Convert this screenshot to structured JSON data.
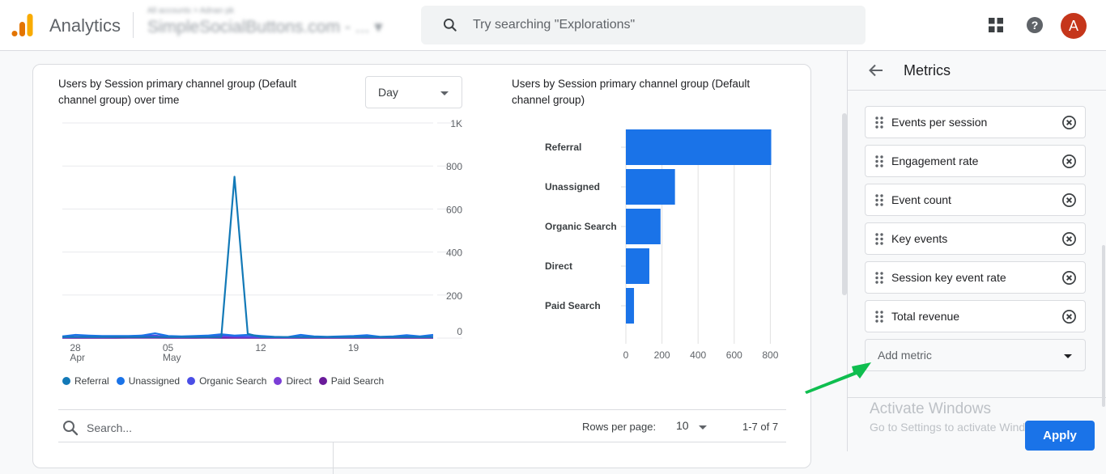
{
  "header": {
    "app_name": "Analytics",
    "account_breadcrumb": "All accounts > Adnan pk",
    "property_name": "SimpleSocialButtons.com - ...",
    "search_placeholder": "Try searching \"Explorations\"",
    "avatar_initial": "A",
    "icons": [
      "apps-grid-icon",
      "help-icon"
    ]
  },
  "card": {
    "line_chart_title": "Users by Session primary channel group (Default channel group) over time",
    "line_chart_title_lines": [
      "Users by Session primary channel group (Default",
      "channel group) over time"
    ],
    "granularity_select": "Day",
    "bar_chart_title_lines": [
      "Users by Session primary channel group (Default",
      "channel group)"
    ],
    "legend": [
      {
        "label": "Referral",
        "color": "#1279b7"
      },
      {
        "label": "Unassigned",
        "color": "#1a73e8"
      },
      {
        "label": "Organic Search",
        "color": "#4a4ee6"
      },
      {
        "label": "Direct",
        "color": "#7b3ed6"
      },
      {
        "label": "Paid Search",
        "color": "#6a1b9a"
      }
    ],
    "table": {
      "search_placeholder": "Search...",
      "rows_per_page_label": "Rows per page:",
      "rows_per_page_value": "10",
      "range_text": "1-7 of 7"
    }
  },
  "chart_data": [
    {
      "type": "line",
      "title": "Users by Session primary channel group (Default channel group) over time",
      "xlabel": "",
      "ylabel": "",
      "ylim": [
        0,
        1000
      ],
      "y_ticks": [
        "0",
        "200",
        "400",
        "600",
        "800",
        "1K"
      ],
      "x_tick_labels": [
        {
          "day": "28",
          "month": "Apr",
          "index": 1
        },
        {
          "day": "05",
          "month": "May",
          "index": 8
        },
        {
          "day": "12",
          "month": "",
          "index": 15
        },
        {
          "day": "19",
          "month": "",
          "index": 22
        }
      ],
      "x": [
        "Apr 27",
        "Apr 28",
        "Apr 29",
        "Apr 30",
        "May 1",
        "May 2",
        "May 3",
        "May 4",
        "May 5",
        "May 6",
        "May 7",
        "May 8",
        "May 9",
        "May 10",
        "May 11",
        "May 12",
        "May 13",
        "May 14",
        "May 15",
        "May 16",
        "May 17",
        "May 18",
        "May 19",
        "May 20",
        "May 21",
        "May 22",
        "May 23",
        "May 24",
        "May 25"
      ],
      "series": [
        {
          "name": "Referral",
          "color": "#1279b7",
          "values": [
            5,
            5,
            5,
            5,
            5,
            5,
            5,
            5,
            5,
            5,
            5,
            5,
            5,
            750,
            20,
            5,
            5,
            5,
            5,
            5,
            5,
            5,
            5,
            5,
            5,
            5,
            5,
            5,
            5
          ]
        },
        {
          "name": "Unassigned",
          "color": "#1a73e8",
          "values": [
            8,
            15,
            12,
            10,
            10,
            10,
            12,
            22,
            10,
            8,
            10,
            12,
            18,
            12,
            15,
            10,
            6,
            5,
            15,
            8,
            6,
            8,
            10,
            14,
            6,
            8,
            14,
            8,
            15
          ]
        },
        {
          "name": "Organic Search",
          "color": "#4a4ee6",
          "values": [
            4,
            6,
            6,
            6,
            6,
            8,
            12,
            10,
            6,
            6,
            8,
            10,
            12,
            8,
            6,
            5,
            4,
            5,
            6,
            5,
            5,
            5,
            6,
            6,
            5,
            5,
            8,
            5,
            6
          ]
        },
        {
          "name": "Direct",
          "color": "#7b3ed6",
          "values": [
            3,
            4,
            4,
            4,
            5,
            8,
            10,
            12,
            5,
            4,
            5,
            6,
            8,
            6,
            5,
            4,
            3,
            3,
            4,
            4,
            4,
            4,
            4,
            4,
            4,
            4,
            5,
            4,
            4
          ]
        },
        {
          "name": "Paid Search",
          "color": "#6a1b9a",
          "values": [
            1,
            1,
            1,
            1,
            1,
            2,
            2,
            2,
            1,
            1,
            1,
            2,
            1,
            1,
            1,
            1,
            1,
            1,
            1,
            1,
            1,
            1,
            1,
            1,
            1,
            1,
            1,
            1,
            1
          ]
        }
      ],
      "grid": true,
      "legend_position": "bottom-left"
    },
    {
      "type": "bar",
      "orientation": "horizontal",
      "title": "Users by Session primary channel group (Default channel group)",
      "categories": [
        "Referral",
        "Unassigned",
        "Organic Search",
        "Direct",
        "Paid Search"
      ],
      "values": [
        805,
        272,
        192,
        130,
        45
      ],
      "color": "#1a73e8",
      "xlim": [
        0,
        1000
      ],
      "x_ticks": [
        "0",
        "200",
        "400",
        "600",
        "800",
        "1K"
      ],
      "grid": true
    }
  ],
  "panel": {
    "title": "Metrics",
    "metrics": [
      {
        "label": "Events per session"
      },
      {
        "label": "Engagement rate"
      },
      {
        "label": "Event count"
      },
      {
        "label": "Key events"
      },
      {
        "label": "Session key event rate"
      },
      {
        "label": "Total revenue"
      }
    ],
    "add_metric_label": "Add metric",
    "apply_label": "Apply",
    "windows_watermark_title": "Activate Windows",
    "windows_watermark_sub": "Go to Settings to activate Windows."
  },
  "annotation": {
    "arrow_color": "#0fbe4f"
  }
}
